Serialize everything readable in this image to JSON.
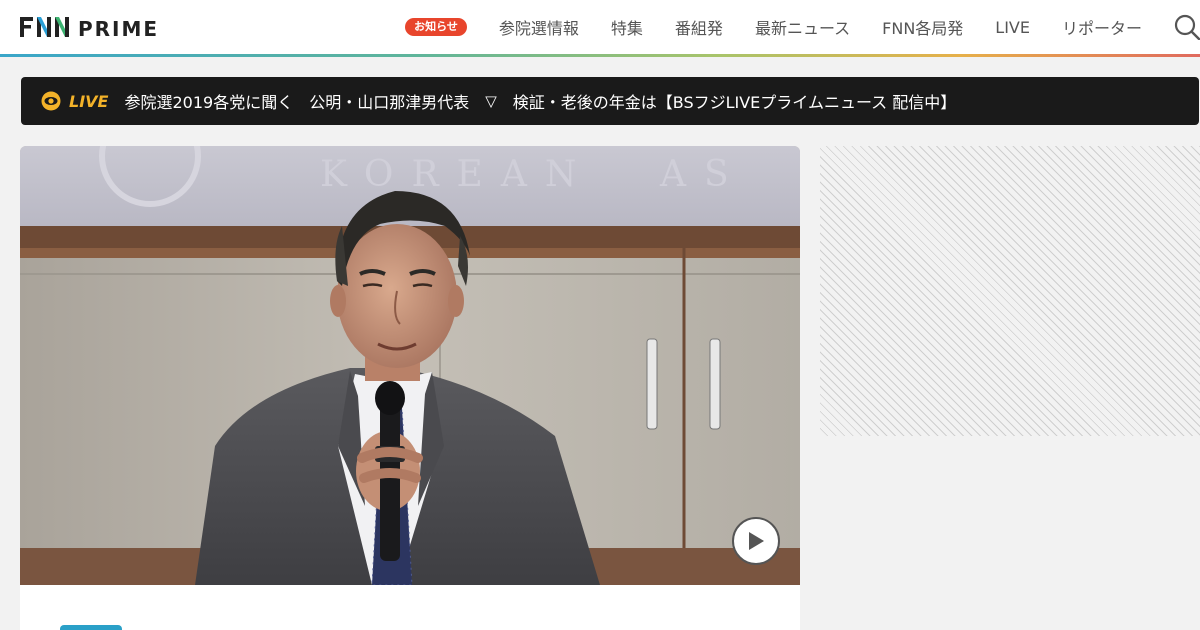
{
  "header": {
    "logo": "FNN PRIME",
    "logo_colors": [
      "#e8452c",
      "#2a9fd6",
      "#f3b229",
      "#3cb371"
    ],
    "nav": {
      "badge": "お知らせ",
      "items": [
        "参院選情報",
        "特集",
        "番組発",
        "最新ニュース",
        "FNN各局発",
        "LIVE",
        "リポーター"
      ],
      "search_icon": "search-icon"
    }
  },
  "ticker": {
    "live_label": "LIVE",
    "headlines": [
      "参院選2019各党に聞く　公明・山口那津男代表",
      "検証・老後の年金は【BSフジLIVEプライムニュース 配信中】"
    ],
    "separator": "▽"
  },
  "article": {
    "play_icon": "play-icon"
  },
  "colors": {
    "accent_live": "#f3b229",
    "badge": "#e8452c",
    "tag": "#2aa0c8"
  }
}
